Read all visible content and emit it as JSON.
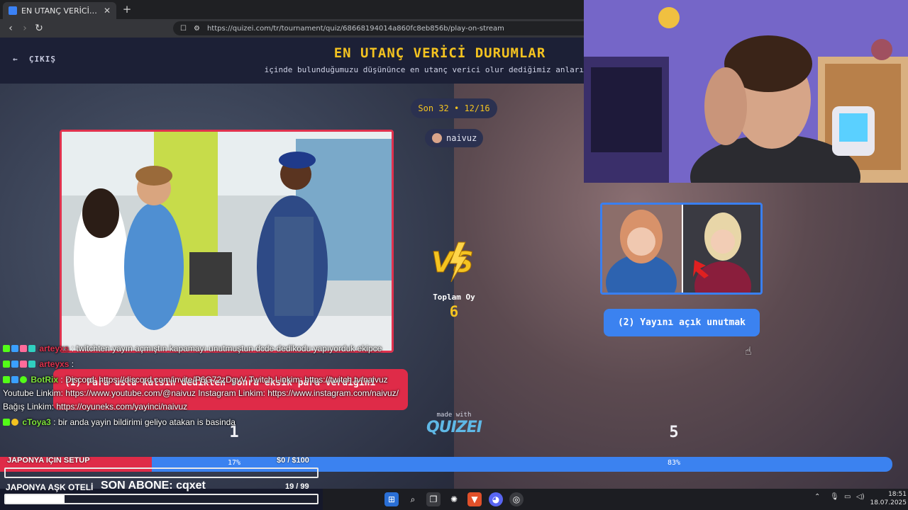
{
  "browser": {
    "tab_title": "EN UTANÇ VERİCİ DURUMLAR -",
    "tab_close": "✕",
    "new_tab": "+",
    "url": "https://quizei.com/tr/tournament/quiz/68668194014a860fc8eb856b/play-on-stream"
  },
  "quiz": {
    "exit_label": "ÇIKIŞ",
    "title": "EN UTANÇ VERİCİ DURUMLAR",
    "subtitle": "içinde bulunduğumuzu düşününce en utanç verici olur dediğimiz anları",
    "round": "Son 32 • 12/16",
    "username": "naivuz",
    "total_label": "Toplam Oy",
    "total_votes": "6",
    "made_with": "made with",
    "brand": "QUIZEI"
  },
  "options": [
    {
      "label": "(1) Para üstü kalsın dedikten sonra eksik para verdiğini",
      "votes": "1",
      "percent_text": "17%",
      "percent": 17,
      "color": "#df2b48"
    },
    {
      "label": "(2) Yayını açık unutmak",
      "votes": "5",
      "percent_text": "83%",
      "percent": 83,
      "color": "#3b82f0"
    }
  ],
  "chat": [
    {
      "user": "arteyxs",
      "user_color": "#e0324e",
      "message": ": twitchten yayın açmıştın kapamayı unutmuştun dcde dedikodu yapıyorduk ekipce"
    },
    {
      "user": "arteyxs",
      "user_color": "#e0324e",
      "message": ":"
    },
    {
      "user": "BotRix",
      "user_color": "#7ee33a",
      "message": ": Discord: https://discord.com/invite/P6G72zDgvV Twitch Linkim: https://twitch.tv/naivuz Youtube Linkim: https://www.youtube.com/@naivuz Instagram Linkim: https://www.instagram.com/naivuz/ Bağış Linkim: https://oyuneks.com/yayinci/naivuz"
    },
    {
      "user": "cToya3",
      "user_color": "#7ee33a",
      "message": ": bir anda yayin bildirimi geliyo atakan is basinda"
    }
  ],
  "goals": {
    "goal1_title": "JAPONYA IÇIN SETUP",
    "goal1_amount": "$0  / $100",
    "goal1_progress": 0,
    "goal2_title": "JAPONYA AŞK OTELİ",
    "sub_label": "SON ABONE: cqxet",
    "goal2_count": "19  / 99",
    "goal2_progress": 0.19
  },
  "taskbar": {
    "time": "18:51",
    "date": "18.07.2025"
  }
}
